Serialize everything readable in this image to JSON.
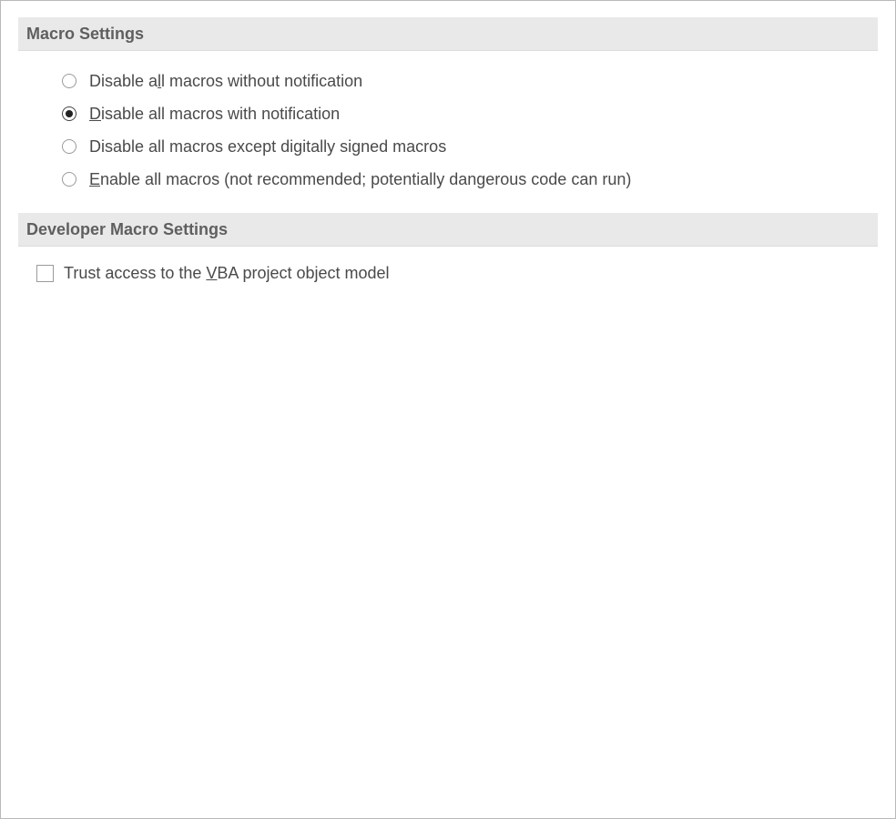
{
  "macro_settings": {
    "title": "Macro Settings",
    "options": [
      {
        "pre": "Disable a",
        "accel": "l",
        "post": "l macros without notification",
        "selected": false
      },
      {
        "pre": "",
        "accel": "D",
        "post": "isable all macros with notification",
        "selected": true
      },
      {
        "pre": "Disable all macros except di",
        "accel": "g",
        "post": "itally signed macros",
        "selected": false
      },
      {
        "pre": "",
        "accel": "E",
        "post": "nable all macros (not recommended; potentially dangerous code can run)",
        "selected": false
      }
    ]
  },
  "developer_macro_settings": {
    "title": "Developer Macro Settings",
    "trust_vba": {
      "pre": "Trust access to the ",
      "accel": "V",
      "post": "BA project object model",
      "checked": false
    }
  }
}
